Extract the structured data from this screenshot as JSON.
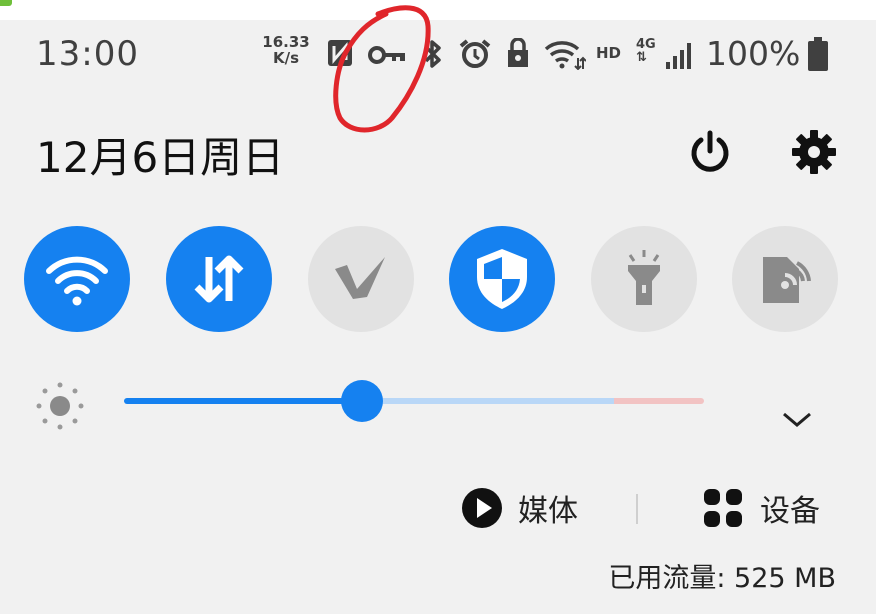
{
  "status_bar": {
    "time": "13:00",
    "speed_value": "16.33",
    "speed_unit": "K/s",
    "hd_label": "HD",
    "network_label": "4G",
    "battery_percent": "100%",
    "icons": [
      "nfc-icon",
      "vpn-key-icon",
      "bluetooth-icon",
      "alarm-icon",
      "secure-folder-icon",
      "wifi-icon",
      "hd-icon",
      "mobile-data-icon",
      "signal-icon",
      "battery-icon"
    ]
  },
  "header": {
    "date": "12月6日周日",
    "power_icon": "power-icon",
    "settings_icon": "gear-icon"
  },
  "quick_tiles": [
    {
      "icon": "wifi-icon",
      "state": "on"
    },
    {
      "icon": "mobile-data-icon",
      "state": "on"
    },
    {
      "icon": "vpn-v-icon",
      "state": "off"
    },
    {
      "icon": "shield-icon",
      "state": "on"
    },
    {
      "icon": "flashlight-icon",
      "state": "off"
    },
    {
      "icon": "nfc-tag-icon",
      "state": "off"
    }
  ],
  "brightness": {
    "level": 0.41,
    "icon": "brightness-icon",
    "expand_icon": "chevron-down-icon"
  },
  "media_row": {
    "media_label": "媒体",
    "devices_label": "设备"
  },
  "data_usage": "已用流量: 525 MB",
  "colors": {
    "accent": "#1581f0",
    "tile_off": "#e2e2e2",
    "panel_bg": "#f1f1f1",
    "annotation_red": "#e0262b"
  }
}
